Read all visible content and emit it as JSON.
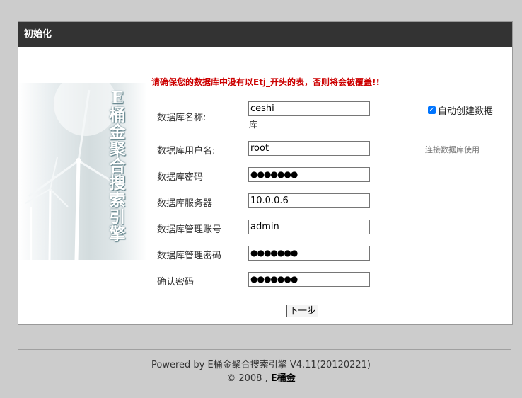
{
  "panel": {
    "title": "初始化"
  },
  "warning": "请确保您的数据库中没有以Etj_开头的表，否则将会被覆盖!!",
  "banner": {
    "title": "E桶金聚合搜索引擎"
  },
  "form": {
    "db_name_label": "数据库名称:",
    "db_name_value": "ceshi",
    "db_name_note": "库",
    "auto_create_label": "自动创建数据",
    "db_user_label": "数据库用户名:",
    "db_user_value": "root",
    "db_user_hint": "连接数据库使用",
    "db_pwd_label": "数据库密码",
    "db_pwd_value": "●●●●●●●",
    "db_server_label": "数据库服务器",
    "db_server_value": "10.0.0.6",
    "admin_account_label": "数据库管理账号",
    "admin_account_value": "admin",
    "admin_pwd_label": "数据库管理密码",
    "admin_pwd_value": "●●●●●●●",
    "confirm_pwd_label": "确认密码",
    "confirm_pwd_value": "●●●●●●●",
    "next_button": "下一步"
  },
  "footer": {
    "powered": "Powered by E桶金聚合搜索引擎 V4.11(20120221)",
    "copyright_prefix": "© 2008 , ",
    "copyright_brand": "E桶金"
  }
}
